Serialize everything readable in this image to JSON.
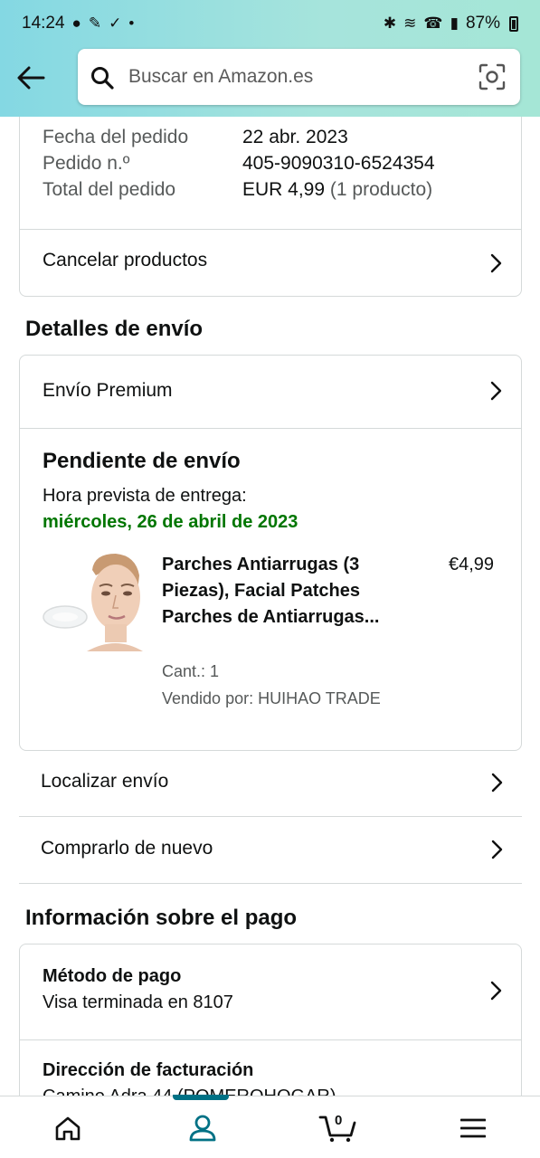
{
  "status_bar": {
    "time": "14:24",
    "battery": "87%"
  },
  "search": {
    "placeholder": "Buscar en Amazon.es"
  },
  "order_summary": {
    "rows": [
      {
        "label": "Fecha del pedido",
        "value": "22 abr. 2023"
      },
      {
        "label": "Pedido n.º",
        "value": "405-9090310-6524354"
      },
      {
        "label": "Total del pedido",
        "value": "EUR 4,99",
        "extra": "(1 producto)"
      }
    ],
    "cancel_label": "Cancelar productos"
  },
  "shipping": {
    "section_title": "Detalles de envío",
    "method": "Envío Premium",
    "status_title": "Pendiente de envío",
    "delivery_label": "Hora prevista de entrega:",
    "delivery_date": "miércoles, 26 de abril de 2023",
    "product": {
      "title": "Parches Antiarrugas (3 Piezas), Facial Patches Parches de Antiarrugas...",
      "price": "€4,99",
      "qty": "Cant.: 1",
      "seller": "Vendido por: HUIHAO TRADE"
    },
    "track_label": "Localizar envío",
    "buy_again_label": "Comprarlo de nuevo"
  },
  "payment": {
    "section_title": "Información sobre el pago",
    "method_title": "Método de pago",
    "method_value": "Visa terminada en 8107",
    "billing_title": "Dirección de facturación",
    "billing_value": "Camino Adra 44 (POMEROHOGAR)"
  },
  "bottom_nav": {
    "cart_count": "0",
    "active": "account"
  },
  "colors": {
    "header_gradient_start": "#84d8e3",
    "header_gradient_end": "#a5e6d6",
    "delivery_green": "#007600",
    "nav_active": "#007185"
  }
}
